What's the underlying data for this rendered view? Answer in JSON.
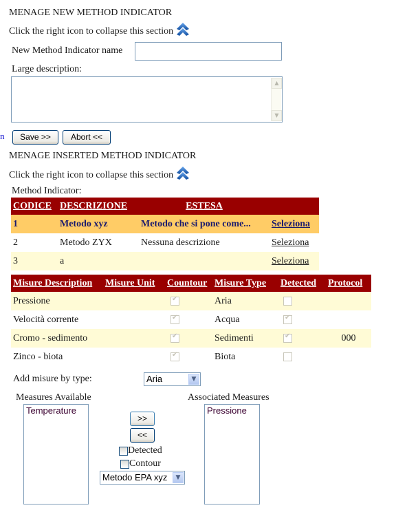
{
  "new_section": {
    "title": "MENAGE NEW METHOD INDICATOR",
    "collapse_text": "Click the right icon to collapse this section",
    "collapse_icon": "double-chevron-up-icon",
    "name_label": "New Method Indicator name",
    "name_value": "",
    "description_label": "Large description:",
    "description_value": "",
    "stray_text": "n",
    "save_label": "Save >>",
    "abort_label": "Abort <<"
  },
  "inserted_section": {
    "title": "MENAGE INSERTED METHOD INDICATOR",
    "collapse_text": "Click the right icon to collapse this section",
    "collapse_icon": "double-chevron-up-icon",
    "method_indicator_label": "Method Indicator:",
    "methods_table": {
      "headers": [
        "CODICE",
        "DESCRIZIONE",
        "ESTESA",
        ""
      ],
      "rows": [
        {
          "codice": "1",
          "descrizione": "Metodo xyz",
          "estesa": "Metodo che si pone come...",
          "action": "Seleziona",
          "selected": true
        },
        {
          "codice": "2",
          "descrizione": "Metodo ZYX",
          "estesa": "Nessuna descrizione",
          "action": "Seleziona",
          "selected": false
        },
        {
          "codice": "3",
          "descrizione": "a",
          "estesa": "",
          "action": "Seleziona",
          "selected": false
        }
      ]
    },
    "measures_table": {
      "headers": [
        "Misure Description",
        "Misure Unit",
        "Countour",
        "Misure Type",
        "Detected",
        "Protocol"
      ],
      "rows": [
        {
          "description": "Pressione",
          "unit": "",
          "contour": true,
          "type": "Aria",
          "detected": false,
          "protocol": ""
        },
        {
          "description": "Velocità corrente",
          "unit": "",
          "contour": true,
          "type": "Acqua",
          "detected": true,
          "protocol": ""
        },
        {
          "description": "Cromo - sedimento",
          "unit": "",
          "contour": true,
          "type": "Sedimenti",
          "detected": true,
          "protocol": "000"
        },
        {
          "description": "Zinco - biota",
          "unit": "",
          "contour": true,
          "type": "Biota",
          "detected": false,
          "protocol": ""
        }
      ]
    },
    "add_by_type_label": "Add misure by type:",
    "type_select_value": "Aria",
    "available_label": "Measures Available",
    "available_items": [
      "Temperature"
    ],
    "associated_label": "Associated Measures",
    "associated_items": [
      "Pressione"
    ],
    "add_button": ">>",
    "remove_button": "<<",
    "detected_label": "Detected",
    "detected_checked": false,
    "contour_label": "Contour",
    "contour_checked": false,
    "protocol_select_value": "Metodo EPA xyz"
  },
  "colors": {
    "header_bg": "#990000",
    "selected_row_bg": "#ffcc66",
    "alt_row_bg": "#fffbd6",
    "icon_blue": "#1d5fb8"
  }
}
